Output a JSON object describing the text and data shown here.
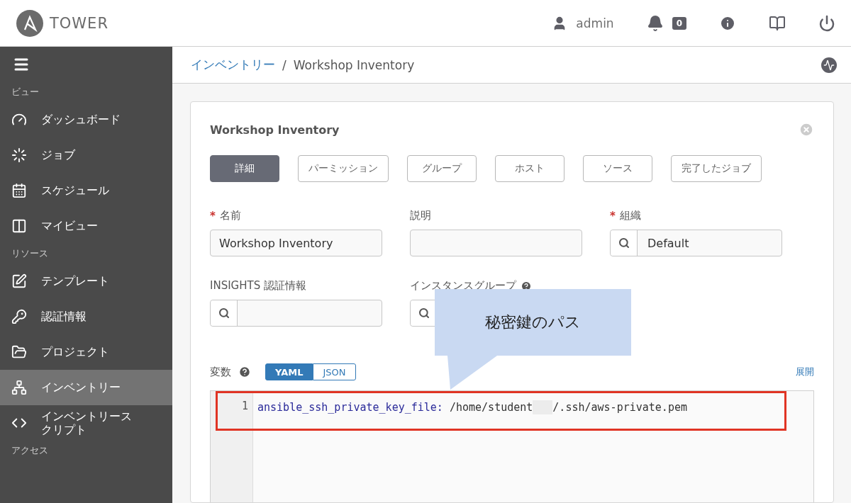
{
  "header": {
    "logo_text": "TOWER",
    "user": "admin",
    "notification_count": "0"
  },
  "sidebar": {
    "sections": [
      {
        "title": "ビュー",
        "items": [
          {
            "label": "ダッシュボード",
            "selected": false
          },
          {
            "label": "ジョブ",
            "selected": false
          },
          {
            "label": "スケジュール",
            "selected": false
          },
          {
            "label": "マイビュー",
            "selected": false
          }
        ]
      },
      {
        "title": "リソース",
        "items": [
          {
            "label": "テンプレート",
            "selected": false
          },
          {
            "label": "認証情報",
            "selected": false
          },
          {
            "label": "プロジェクト",
            "selected": false
          },
          {
            "label": "インベントリー",
            "selected": true
          },
          {
            "label": "インベントリースクリプト",
            "selected": false
          }
        ]
      },
      {
        "title": "アクセス"
      }
    ]
  },
  "breadcrumb": {
    "parent": "インベントリー",
    "separator": "/",
    "current": "Workshop Inventory"
  },
  "card": {
    "title": "Workshop Inventory",
    "required_mark": "*",
    "tabs": [
      {
        "label": "詳細",
        "selected": true
      },
      {
        "label": "パーミッション",
        "selected": false
      },
      {
        "label": "グループ",
        "selected": false
      },
      {
        "label": "ホスト",
        "selected": false
      },
      {
        "label": "ソース",
        "selected": false
      },
      {
        "label": "完了したジョブ",
        "selected": false
      }
    ],
    "fields": [
      {
        "label": "名前",
        "required": true,
        "kind": "text",
        "value": "Workshop Inventory"
      },
      {
        "label": "説明",
        "required": false,
        "kind": "text"
      },
      {
        "label": "組織",
        "required": true,
        "kind": "lookup",
        "value": "Default"
      },
      {
        "label": "INSIGHTS 認証情報",
        "required": false,
        "kind": "lookup"
      },
      {
        "label": "インスタンスグループ",
        "required": false,
        "kind": "lookup",
        "help": true
      }
    ],
    "variables": {
      "label": "変数",
      "modes": [
        {
          "label": "YAML",
          "selected": true
        },
        {
          "label": "JSON",
          "selected": false
        }
      ],
      "expand": "展開",
      "lines": [
        {
          "number": "1",
          "key": "ansible_ssh_private_key_file:",
          "value_parts": [
            "/home/student",
            "/.ssh/aws-private.pem"
          ]
        }
      ]
    }
  },
  "callout": {
    "text": "秘密鍵のパス"
  }
}
